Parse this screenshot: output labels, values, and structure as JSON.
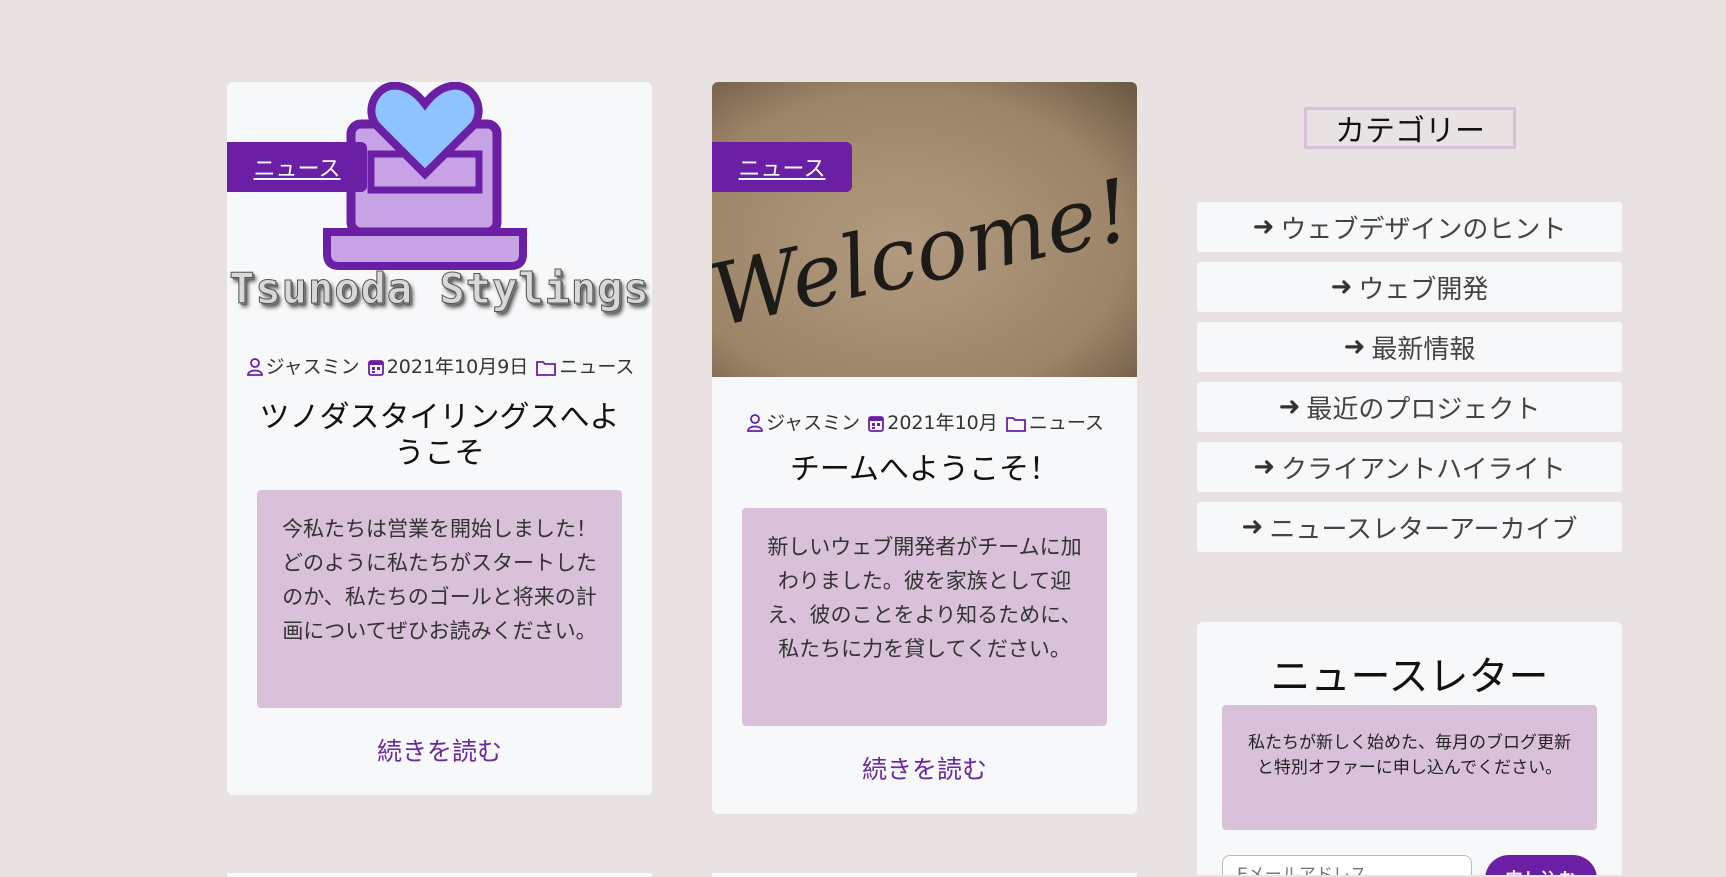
{
  "posts": [
    {
      "category_badge": "ニュース",
      "brand_text": "Tsunoda Stylings",
      "author": "ジャスミン",
      "date": "2021年10月9日",
      "category": "ニュース",
      "title": "ツノダスタイリングスへようこそ",
      "excerpt": "今私たちは営業を開始しました！どのように私たちがスタートしたのか、私たちのゴールと将来の計画についてぜひお読みください。",
      "read_more": "続きを読む"
    },
    {
      "category_badge": "ニュース",
      "image_text": "Welcome!",
      "author": "ジャスミン",
      "date": "2021年10月",
      "category": "ニュース",
      "title": "チームへようこそ！",
      "excerpt": "新しいウェブ開発者がチームに加わりました。彼を家族として迎え、彼のことをより知るために、私たちに力を貸してください。",
      "read_more": "続きを読む"
    }
  ],
  "sidebar": {
    "categories_title": "カテゴリー",
    "categories": [
      "ウェブデザインのヒント",
      "ウェブ開発",
      "最新情報",
      "最近のプロジェクト",
      "クライアントハイライト",
      "ニュースレターアーカイブ"
    ],
    "newsletter": {
      "title": "ニュースレター",
      "description": "私たちが新しく始めた、毎月のブログ更新と特別オファーに申し込んでください。",
      "input_placeholder": "Eメールアドレス",
      "button_label": "申し込む"
    }
  },
  "colors": {
    "background": "#e8e2e3",
    "card": "#f7f8fa",
    "accent_purple": "#6a1fa5",
    "excerpt_box": "#d8c1d9",
    "link": "#6a2aa0"
  }
}
